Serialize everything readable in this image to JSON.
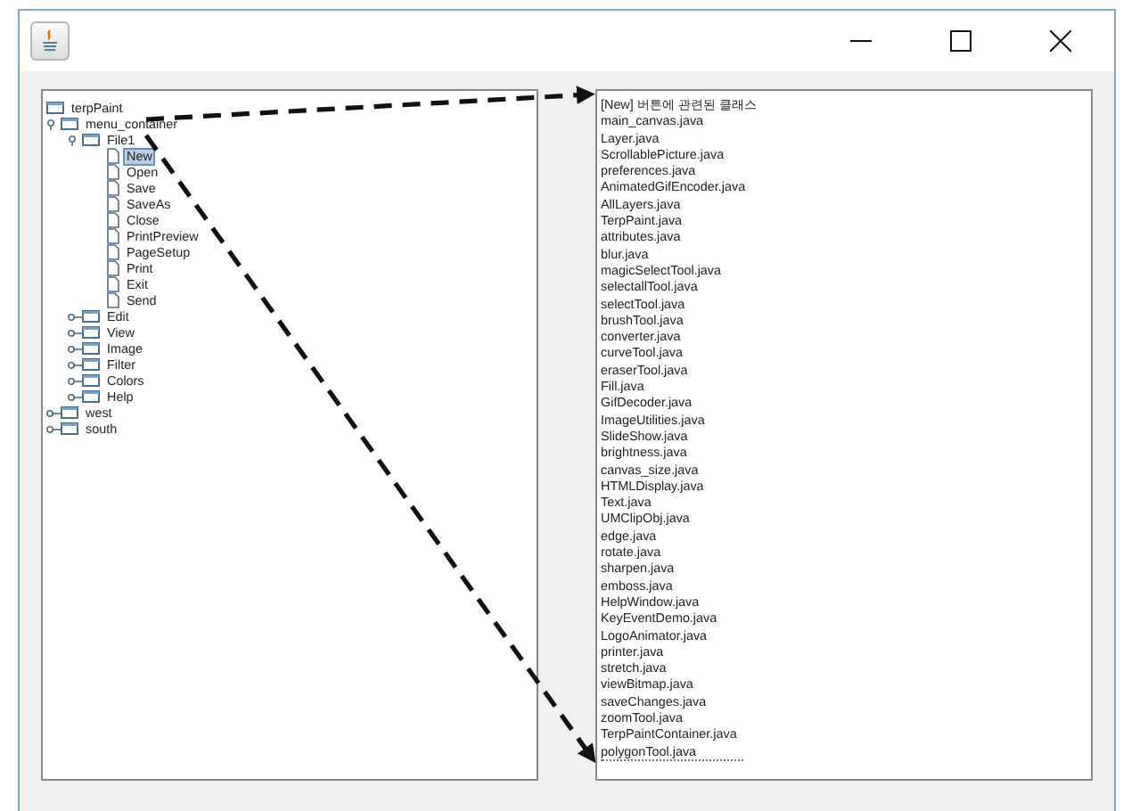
{
  "tree": [
    {
      "label": "terpPaint",
      "kind": "folder",
      "children": [
        {
          "label": "menu_container",
          "kind": "folder",
          "expanded": true,
          "children": [
            {
              "label": "File1",
              "kind": "folder",
              "expanded": true,
              "children": [
                {
                  "label": "New",
                  "kind": "leaf",
                  "selected": true
                },
                {
                  "label": "Open",
                  "kind": "leaf",
                  "selected": false
                },
                {
                  "label": "Save",
                  "kind": "leaf",
                  "selected": false
                },
                {
                  "label": "SaveAs",
                  "kind": "leaf",
                  "selected": false
                },
                {
                  "label": "Close",
                  "kind": "leaf",
                  "selected": false
                },
                {
                  "label": "PrintPreview",
                  "kind": "leaf",
                  "selected": false
                },
                {
                  "label": "PageSetup",
                  "kind": "leaf",
                  "selected": false
                },
                {
                  "label": "Print",
                  "kind": "leaf",
                  "selected": false
                },
                {
                  "label": "Exit",
                  "kind": "leaf",
                  "selected": false
                },
                {
                  "label": "Send",
                  "kind": "leaf",
                  "selected": false
                }
              ]
            },
            {
              "label": "Edit",
              "kind": "folder",
              "expanded": false
            },
            {
              "label": "View",
              "kind": "folder",
              "expanded": false
            },
            {
              "label": "Image",
              "kind": "folder",
              "expanded": false
            },
            {
              "label": "Filter",
              "kind": "folder",
              "expanded": false
            },
            {
              "label": "Colors",
              "kind": "folder",
              "expanded": false
            },
            {
              "label": "Help",
              "kind": "folder",
              "expanded": false
            }
          ]
        },
        {
          "label": "west",
          "kind": "folder",
          "expanded": false
        },
        {
          "label": "south",
          "kind": "folder",
          "expanded": false
        }
      ]
    }
  ],
  "list": [
    "[New] 버튼에 관련된 클래스",
    "main_canvas.java",
    "Layer.java",
    "ScrollablePicture.java",
    "preferences.java",
    "AnimatedGifEncoder.java",
    "AllLayers.java",
    "TerpPaint.java",
    "attributes.java",
    "blur.java",
    "magicSelectTool.java",
    "selectallTool.java",
    "selectTool.java",
    "brushTool.java",
    "converter.java",
    "curveTool.java",
    "eraserTool.java",
    "Fill.java",
    "GifDecoder.java",
    "ImageUtilities.java",
    "SlideShow.java",
    "brightness.java",
    "canvas_size.java",
    "HTMLDisplay.java",
    "Text.java",
    "UMClipObj.java",
    "edge.java",
    "rotate.java",
    "sharpen.java",
    "emboss.java",
    "HelpWindow.java",
    "KeyEventDemo.java",
    "LogoAnimator.java",
    "printer.java",
    "stretch.java",
    "viewBitmap.java",
    "saveChanges.java",
    "zoomTool.java",
    "TerpPaintContainer.java",
    "polygonTool.java"
  ]
}
